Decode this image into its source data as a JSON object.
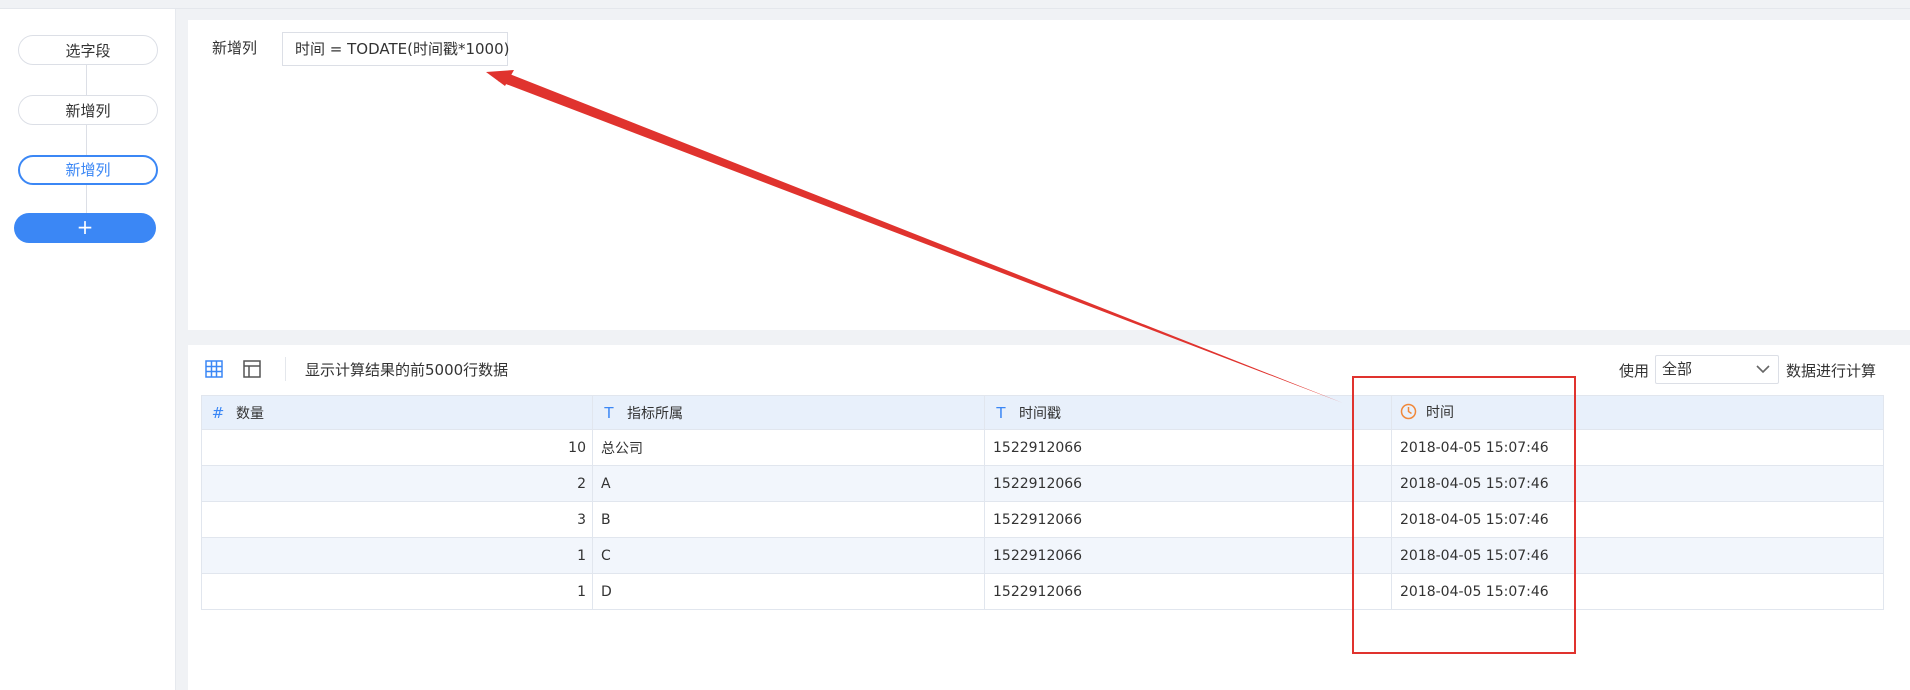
{
  "sidebar": {
    "steps": [
      {
        "label": "选字段"
      },
      {
        "label": "新增列"
      },
      {
        "label": "新增列"
      }
    ],
    "add_label": "+"
  },
  "formula": {
    "label": "新增列",
    "expression": "时间 = TODATE(时间戳*1000)"
  },
  "preview": {
    "note": "显示计算结果的前5000行数据",
    "use_label": "使用",
    "select_value": "全部",
    "calc_label": "数据进行计算",
    "icons": [
      "grid-view-icon",
      "layout-view-icon"
    ]
  },
  "table": {
    "columns": [
      {
        "type_icon": "#",
        "type": "number",
        "label": "数量"
      },
      {
        "type_icon": "T",
        "type": "text",
        "label": "指标所属"
      },
      {
        "type_icon": "T",
        "type": "text",
        "label": "时间戳"
      },
      {
        "type_icon": "clock",
        "type": "datetime",
        "label": "时间"
      }
    ],
    "rows": [
      [
        "10",
        "总公司",
        "1522912066",
        "2018-04-05 15:07:46"
      ],
      [
        "2",
        "A",
        "1522912066",
        "2018-04-05 15:07:46"
      ],
      [
        "3",
        "B",
        "1522912066",
        "2018-04-05 15:07:46"
      ],
      [
        "1",
        "C",
        "1522912066",
        "2018-04-05 15:07:46"
      ],
      [
        "1",
        "D",
        "1522912066",
        "2018-04-05 15:07:46"
      ]
    ]
  },
  "colors": {
    "accent": "#3b87f5",
    "annotation": "#e0332e",
    "time_icon": "#f0883a",
    "header_bg": "#e8f0fb"
  }
}
